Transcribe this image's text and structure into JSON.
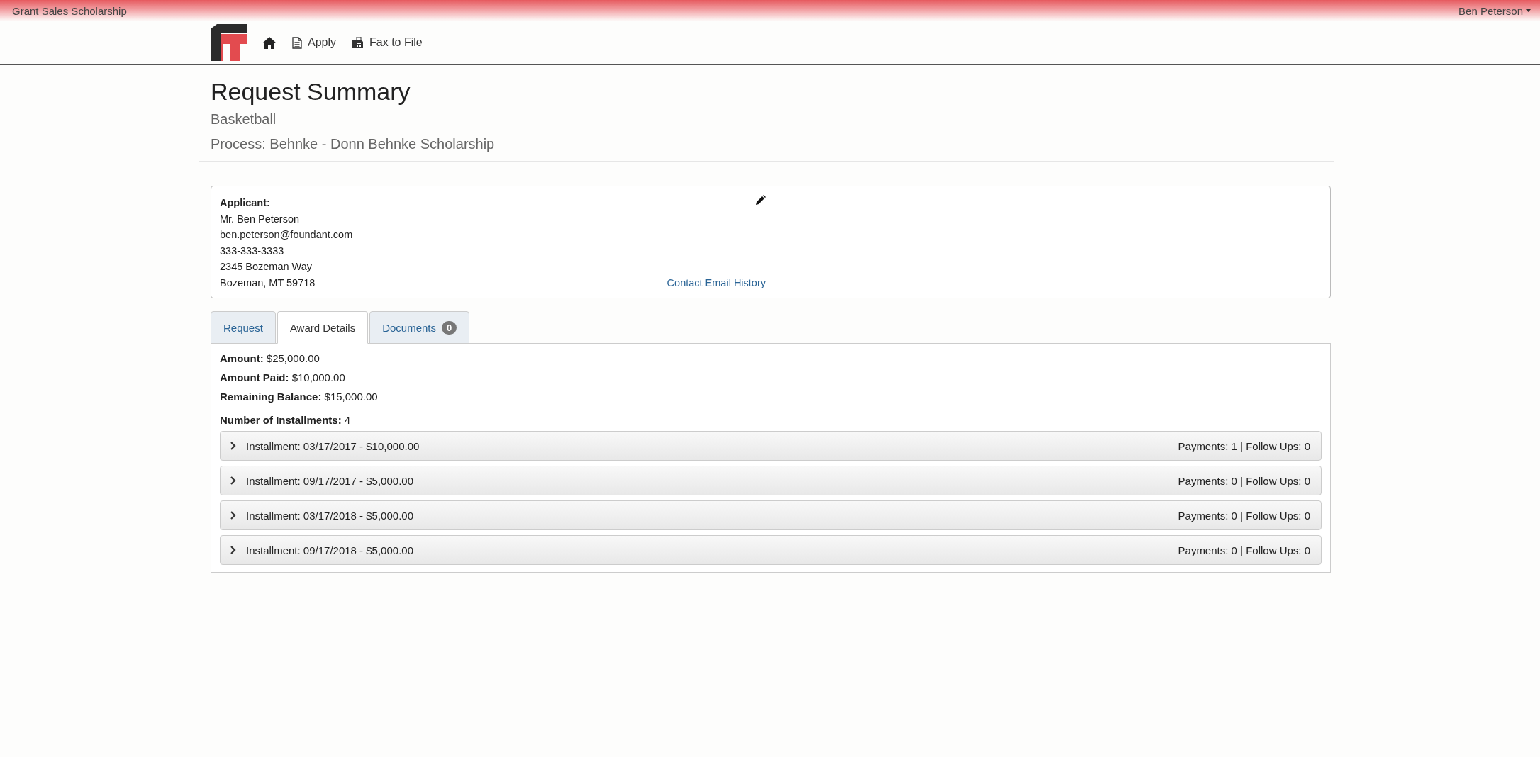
{
  "top_bar": {
    "site_title": "Grant Sales Scholarship",
    "user_menu": "Ben Peterson"
  },
  "nav": {
    "links": [
      {
        "kind": "home"
      },
      {
        "kind": "apply",
        "label": "Apply"
      },
      {
        "kind": "fax",
        "label": "Fax to File"
      }
    ]
  },
  "header": {
    "title": "Request Summary",
    "subtitle": "Basketball",
    "process": "Process: Behnke - Donn Behnke Scholarship"
  },
  "applicant": {
    "heading": "Applicant:",
    "lines": [
      "Mr. Ben Peterson",
      "ben.peterson@foundant.com",
      "333-333-3333",
      "2345 Bozeman Way",
      "Bozeman, MT 59718"
    ],
    "link": "Contact Email History"
  },
  "tabs": [
    {
      "label": "Request",
      "selected": false
    },
    {
      "label": "Award Details",
      "selected": true
    },
    {
      "label": "Documents",
      "badge": "0",
      "selected": false
    }
  ],
  "award": {
    "fields": [
      {
        "label": "Amount:",
        "value": "$25,000.00"
      },
      {
        "label": "Amount Paid:",
        "value": "$10,000.00"
      },
      {
        "label": "Remaining Balance:",
        "value": "$15,000.00"
      }
    ],
    "installments_count": {
      "label": "Number of Installments:",
      "value": "4"
    },
    "installments": [
      {
        "title": "Installment: 03/17/2017 - $10,000.00",
        "summary": "Payments: 1 | Follow Ups: 0",
        "expanded": false
      },
      {
        "title": "Installment: 09/17/2017 - $5,000.00",
        "summary": "Payments: 0 | Follow Ups: 0",
        "expanded": false
      },
      {
        "title": "Installment: 03/17/2018 - $5,000.00",
        "summary": "Payments: 0 | Follow Ups: 0",
        "expanded": false
      },
      {
        "title": "Installment: 09/17/2018 - $5,000.00",
        "summary": "Payments: 0 | Follow Ups: 0",
        "expanded": false
      }
    ]
  }
}
